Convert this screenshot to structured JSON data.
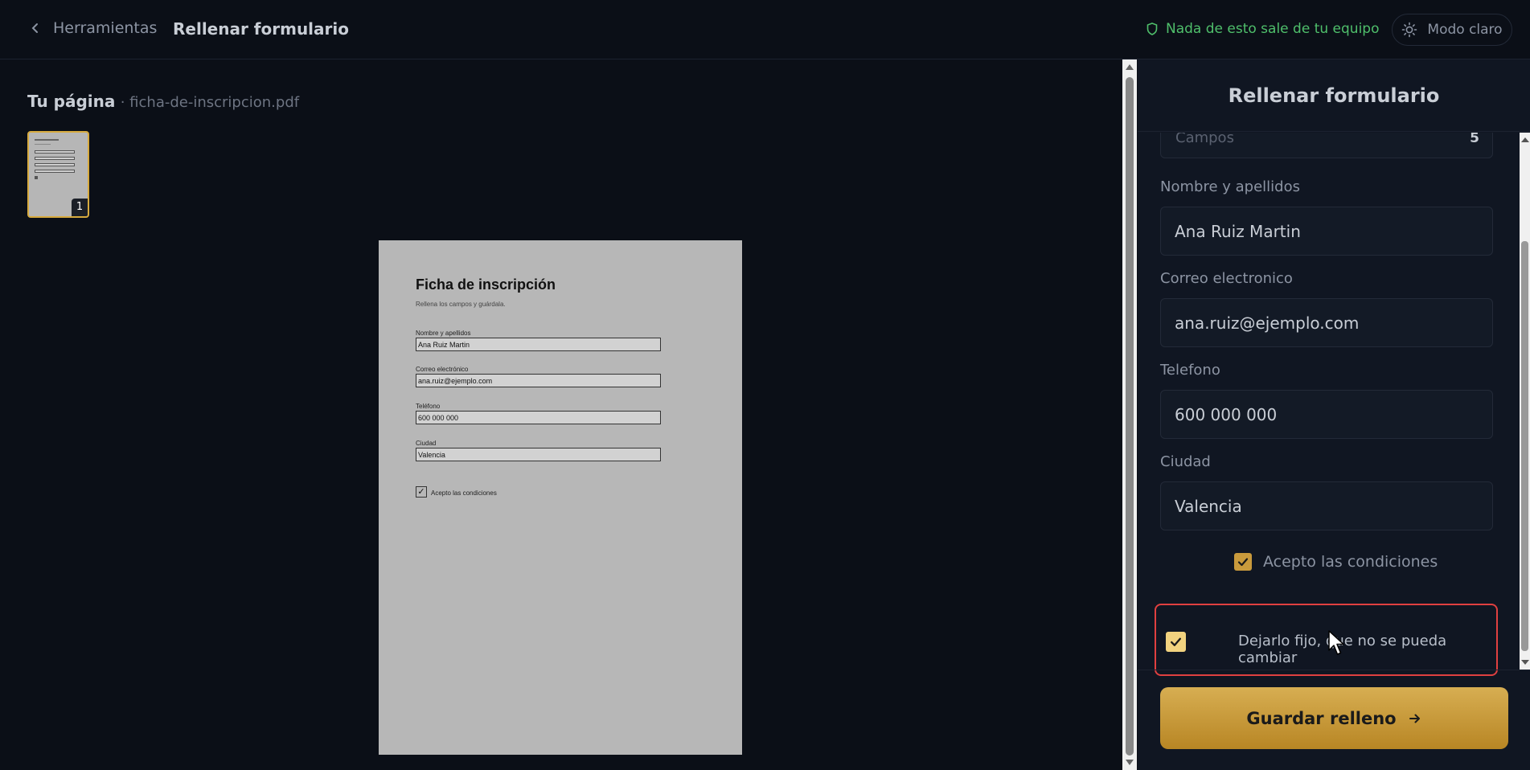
{
  "header": {
    "back_label": "Herramientas",
    "title": "Rellenar formulario",
    "privacy_text": "Nada de esto sale de tu equipo",
    "theme_label": "Modo claro"
  },
  "preview": {
    "heading": "Tu página",
    "filename": "· ficha-de-inscripcion.pdf",
    "thumb_page": "1"
  },
  "pdf": {
    "title": "Ficha de inscripción",
    "subtitle": "Rellena los campos y guárdala.",
    "fields": [
      {
        "label": "Nombre y apellidos",
        "value": "Ana Ruiz Martin"
      },
      {
        "label": "Correo electrónico",
        "value": "ana.ruiz@ejemplo.com"
      },
      {
        "label": "Teléfono",
        "value": "600 000 000"
      },
      {
        "label": "Ciudad",
        "value": "Valencia"
      }
    ],
    "checkbox_mark": "✓",
    "checkbox_label": "Acepto las condiciones"
  },
  "panel": {
    "title": "Rellenar formulario",
    "count_label": "Campos",
    "count_value": "5",
    "fields": [
      {
        "label": "Nombre y apellidos",
        "value": "Ana Ruiz Martin"
      },
      {
        "label": "Correo electronico",
        "value": "ana.ruiz@ejemplo.com"
      },
      {
        "label": "Telefono",
        "value": "600 000 000"
      },
      {
        "label": "Ciudad",
        "value": "Valencia"
      }
    ],
    "accept_label": "Acepto las condiciones",
    "accept_checked": true,
    "lock_label": "Dejarlo fijo, que no se pueda cambiar",
    "lock_checked": true,
    "save_label": "Guardar relleno"
  },
  "colors": {
    "accent": "#d7aa3e",
    "privacy_green": "#4fbf6b",
    "highlight_red": "#e04040"
  },
  "icons": {
    "back": "chevron-left-icon",
    "privacy": "shield-icon",
    "theme": "sun-icon",
    "save": "arrow-right-icon",
    "check": "check-icon"
  }
}
